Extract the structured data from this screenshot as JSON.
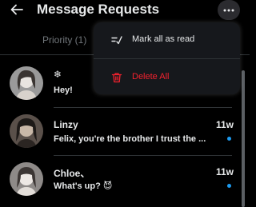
{
  "header": {
    "title": "Message Requests",
    "back_icon": "back-arrow-icon",
    "more_icon": "more-horizontal-icon"
  },
  "tab": {
    "label": "Priority (1)"
  },
  "conversations": [
    {
      "name": "❄",
      "message": "Hey!",
      "time": "",
      "unread": false,
      "avatar_color": "#8a8a8a"
    },
    {
      "name": "Linzy",
      "message": "Felix, you're the brother I trust the ...",
      "time": "11w",
      "unread": true,
      "avatar_color": "#3a3330"
    },
    {
      "name": "Chloe、",
      "message": "What's up? 😈",
      "time": "11w",
      "unread": true,
      "avatar_color": "#6e6a68"
    }
  ],
  "menu": {
    "items": [
      {
        "label": "Mark all as read",
        "icon": "mark-read-icon",
        "color": "#e7e9ea"
      },
      {
        "label": "Delete All",
        "icon": "trash-icon",
        "color": "#f4212e"
      }
    ]
  },
  "colors": {
    "accent": "#1d9bf0",
    "danger": "#f4212e",
    "background": "#000000"
  }
}
